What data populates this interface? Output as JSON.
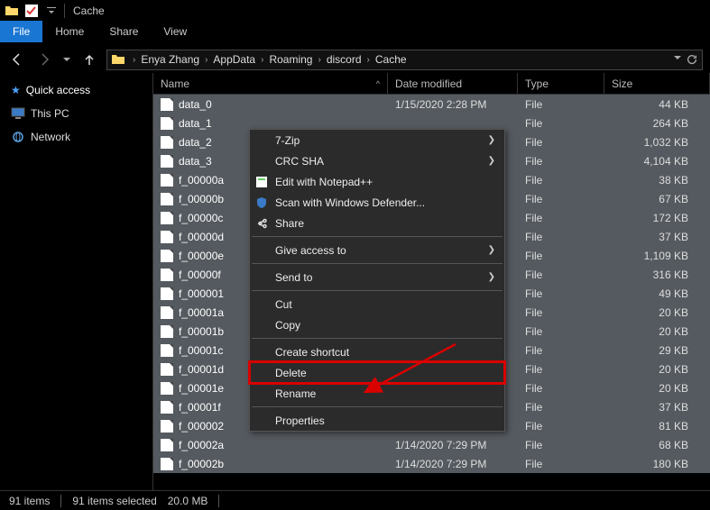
{
  "titlebar": {
    "title": "Cache"
  },
  "tabs": {
    "file": "File",
    "home": "Home",
    "share": "Share",
    "view": "View"
  },
  "breadcrumb": [
    "Enya Zhang",
    "AppData",
    "Roaming",
    "discord",
    "Cache"
  ],
  "sidebar": {
    "quick": "Quick access",
    "pc": "This PC",
    "network": "Network"
  },
  "columns": {
    "name": "Name",
    "date": "Date modified",
    "type": "Type",
    "size": "Size"
  },
  "files": [
    {
      "name": "data_0",
      "date": "1/15/2020 2:28 PM",
      "type": "File",
      "size": "44 KB"
    },
    {
      "name": "data_1",
      "date": "",
      "type": "File",
      "size": "264 KB"
    },
    {
      "name": "data_2",
      "date": "",
      "type": "File",
      "size": "1,032 KB"
    },
    {
      "name": "data_3",
      "date": "",
      "type": "File",
      "size": "4,104 KB"
    },
    {
      "name": "f_00000a",
      "date": "",
      "type": "File",
      "size": "38 KB"
    },
    {
      "name": "f_00000b",
      "date": "",
      "type": "File",
      "size": "67 KB"
    },
    {
      "name": "f_00000c",
      "date": "",
      "type": "File",
      "size": "172 KB"
    },
    {
      "name": "f_00000d",
      "date": "",
      "type": "File",
      "size": "37 KB"
    },
    {
      "name": "f_00000e",
      "date": "",
      "type": "File",
      "size": "1,109 KB"
    },
    {
      "name": "f_00000f",
      "date": "",
      "type": "File",
      "size": "316 KB"
    },
    {
      "name": "f_000001",
      "date": "",
      "type": "File",
      "size": "49 KB"
    },
    {
      "name": "f_00001a",
      "date": "",
      "type": "File",
      "size": "20 KB"
    },
    {
      "name": "f_00001b",
      "date": "",
      "type": "File",
      "size": "20 KB"
    },
    {
      "name": "f_00001c",
      "date": "",
      "type": "File",
      "size": "29 KB"
    },
    {
      "name": "f_00001d",
      "date": "",
      "type": "File",
      "size": "20 KB"
    },
    {
      "name": "f_00001e",
      "date": "",
      "type": "File",
      "size": "20 KB"
    },
    {
      "name": "f_00001f",
      "date": "",
      "type": "File",
      "size": "37 KB"
    },
    {
      "name": "f_000002",
      "date": "",
      "type": "File",
      "size": "81 KB"
    },
    {
      "name": "f_00002a",
      "date": "1/14/2020 7:29 PM",
      "type": "File",
      "size": "68 KB"
    },
    {
      "name": "f_00002b",
      "date": "1/14/2020 7:29 PM",
      "type": "File",
      "size": "180 KB"
    }
  ],
  "context_menu": [
    {
      "label": "7-Zip",
      "sub": true
    },
    {
      "label": "CRC SHA",
      "sub": true
    },
    {
      "label": "Edit with Notepad++",
      "icon": "notepad"
    },
    {
      "label": "Scan with Windows Defender...",
      "icon": "shield"
    },
    {
      "label": "Share",
      "icon": "share"
    },
    {
      "sep": true
    },
    {
      "label": "Give access to",
      "sub": true
    },
    {
      "sep": true
    },
    {
      "label": "Send to",
      "sub": true
    },
    {
      "sep": true
    },
    {
      "label": "Cut"
    },
    {
      "label": "Copy"
    },
    {
      "sep": true
    },
    {
      "label": "Create shortcut"
    },
    {
      "label": "Delete",
      "highlight": true
    },
    {
      "label": "Rename"
    },
    {
      "sep": true
    },
    {
      "label": "Properties"
    }
  ],
  "status": {
    "items": "91 items",
    "selected": "91 items selected",
    "size": "20.0 MB"
  }
}
